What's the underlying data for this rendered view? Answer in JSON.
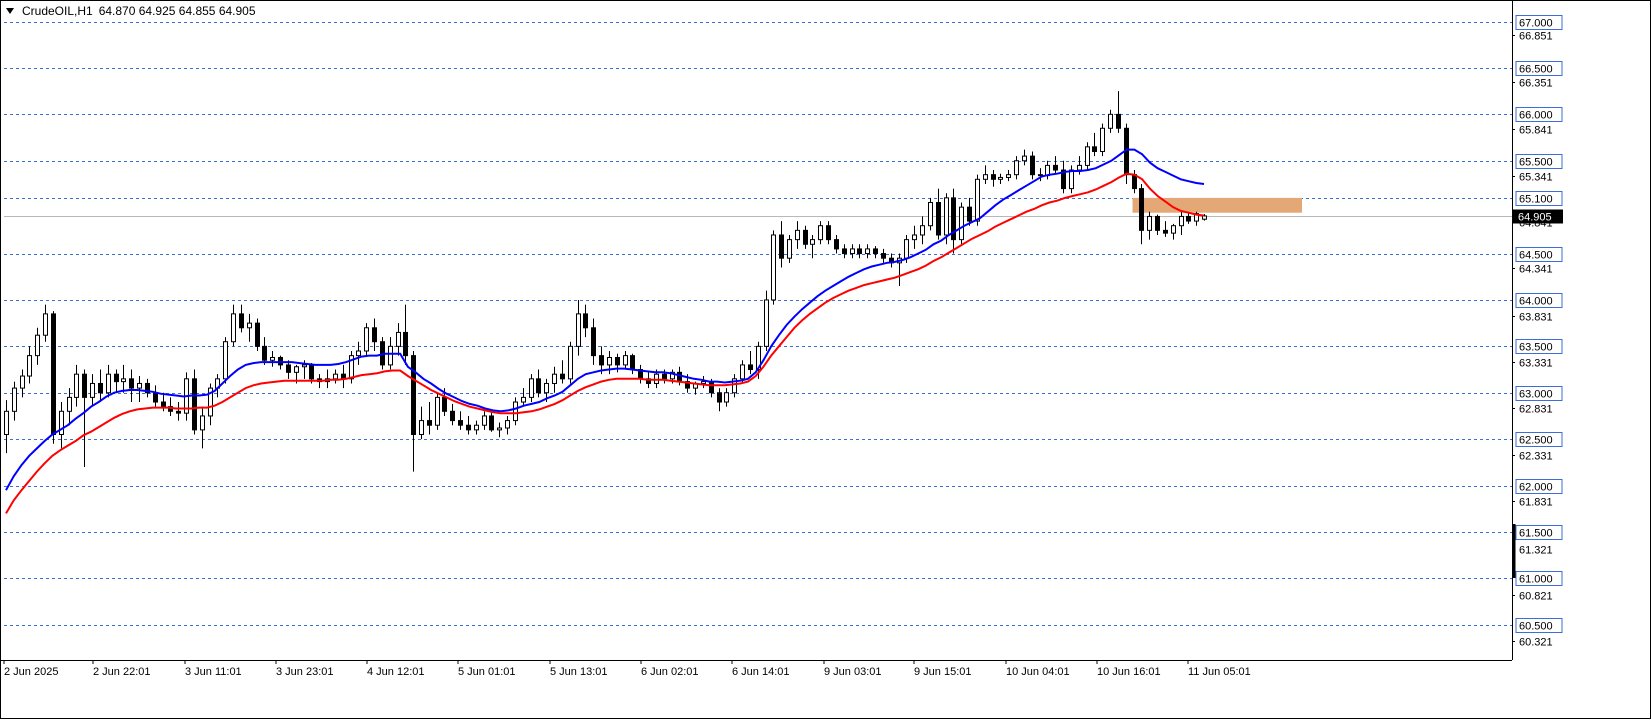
{
  "header": {
    "symbol_tf": "CrudeOIL,H1",
    "ohlc": "64.870 64.925 64.855 64.905"
  },
  "colors": {
    "background": "#ffffff",
    "grid": "#3b6fd6",
    "ema_fast": "#0000ff",
    "ema_slow": "#ff0000",
    "zone": "#e3a875",
    "current_price_bg": "#000000",
    "candle_bull": "#ffffff",
    "candle_bear": "#000000"
  },
  "chart_data": {
    "type": "candlestick",
    "ylim": [
      60.12,
      67.2
    ],
    "grid_levels": [
      67.0,
      66.5,
      66.0,
      65.5,
      65.1,
      64.5,
      64.0,
      63.5,
      63.0,
      62.5,
      62.0,
      61.5,
      61.0,
      60.5
    ],
    "boxed_tick_labels": [
      "67.000",
      "66.500",
      "66.000",
      "65.500",
      "65.100",
      "64.500",
      "64.000",
      "63.500",
      "63.000",
      "62.500",
      "62.000",
      "61.500",
      "61.000",
      "60.500"
    ],
    "plain_tick_labels": [
      "66.851",
      "66.351",
      "65.841",
      "65.341",
      "64.841",
      "64.341",
      "63.831",
      "63.331",
      "62.831",
      "62.331",
      "61.831",
      "61.321",
      "60.821",
      "60.321"
    ],
    "current_price": 64.905,
    "current_price_label": "64.905",
    "x_labels": [
      "2 Jun 2025",
      "2 Jun 22:01",
      "3 Jun 11:01",
      "3 Jun 23:01",
      "4 Jun 12:01",
      "5 Jun 01:01",
      "5 Jun 13:01",
      "6 Jun 02:01",
      "6 Jun 14:01",
      "9 Jun 03:01",
      "9 Jun 15:01",
      "10 Jun 04:01",
      "10 Jun 16:01",
      "11 Jun 05:01"
    ],
    "candles": [
      [
        62.55,
        62.92,
        62.35,
        62.8
      ],
      [
        62.8,
        63.12,
        62.7,
        63.05
      ],
      [
        63.05,
        63.25,
        62.95,
        63.18
      ],
      [
        63.18,
        63.5,
        63.1,
        63.4
      ],
      [
        63.4,
        63.7,
        63.3,
        63.62
      ],
      [
        63.62,
        63.95,
        63.55,
        63.85
      ],
      [
        63.85,
        63.88,
        62.45,
        62.55
      ],
      [
        62.55,
        62.9,
        62.4,
        62.8
      ],
      [
        62.8,
        63.05,
        62.65,
        62.95
      ],
      [
        62.95,
        63.3,
        62.85,
        63.2
      ],
      [
        63.2,
        63.25,
        62.2,
        62.95
      ],
      [
        62.95,
        63.2,
        62.85,
        63.1
      ],
      [
        63.1,
        63.25,
        62.9,
        63.0
      ],
      [
        63.0,
        63.3,
        62.95,
        63.2
      ],
      [
        63.2,
        63.25,
        63.0,
        63.12
      ],
      [
        63.12,
        63.3,
        63.0,
        63.15
      ],
      [
        63.15,
        63.25,
        62.9,
        63.05
      ],
      [
        63.05,
        63.18,
        62.9,
        63.1
      ],
      [
        63.1,
        63.15,
        62.95,
        63.0
      ],
      [
        63.0,
        63.08,
        62.85,
        62.9
      ],
      [
        62.9,
        63.0,
        62.8,
        62.85
      ],
      [
        62.85,
        62.95,
        62.75,
        62.8
      ],
      [
        62.8,
        62.9,
        62.7,
        62.78
      ],
      [
        62.78,
        63.22,
        62.7,
        63.15
      ],
      [
        63.15,
        63.25,
        62.55,
        62.6
      ],
      [
        62.6,
        62.85,
        62.4,
        62.75
      ],
      [
        62.75,
        63.1,
        62.65,
        63.05
      ],
      [
        63.05,
        63.2,
        62.95,
        63.15
      ],
      [
        63.15,
        63.6,
        63.1,
        63.55
      ],
      [
        63.55,
        63.95,
        63.5,
        63.85
      ],
      [
        63.85,
        63.95,
        63.65,
        63.7
      ],
      [
        63.7,
        63.85,
        63.55,
        63.75
      ],
      [
        63.75,
        63.8,
        63.45,
        63.5
      ],
      [
        63.5,
        63.6,
        63.3,
        63.35
      ],
      [
        63.35,
        63.45,
        63.28,
        63.38
      ],
      [
        63.38,
        63.4,
        63.25,
        63.3
      ],
      [
        63.3,
        63.35,
        63.15,
        63.22
      ],
      [
        63.22,
        63.3,
        63.1,
        63.28
      ],
      [
        63.28,
        63.35,
        63.15,
        63.3
      ],
      [
        63.3,
        63.32,
        63.1,
        63.15
      ],
      [
        63.15,
        63.2,
        63.05,
        63.12
      ],
      [
        63.12,
        63.25,
        63.05,
        63.15
      ],
      [
        63.15,
        63.25,
        63.1,
        63.2
      ],
      [
        63.2,
        63.3,
        63.05,
        63.15
      ],
      [
        63.15,
        63.45,
        63.1,
        63.4
      ],
      [
        63.4,
        63.55,
        63.3,
        63.45
      ],
      [
        63.45,
        63.75,
        63.4,
        63.7
      ],
      [
        63.7,
        63.8,
        63.45,
        63.55
      ],
      [
        63.55,
        63.6,
        63.25,
        63.3
      ],
      [
        63.3,
        63.6,
        63.25,
        63.5
      ],
      [
        63.5,
        63.75,
        63.4,
        63.65
      ],
      [
        63.65,
        63.95,
        63.3,
        63.4
      ],
      [
        63.4,
        63.45,
        62.15,
        62.55
      ],
      [
        62.55,
        62.85,
        62.5,
        62.7
      ],
      [
        62.7,
        62.9,
        62.55,
        62.65
      ],
      [
        62.65,
        63.0,
        62.6,
        62.95
      ],
      [
        62.95,
        63.05,
        62.75,
        62.8
      ],
      [
        62.8,
        62.88,
        62.65,
        62.7
      ],
      [
        62.7,
        62.8,
        62.6,
        62.65
      ],
      [
        62.65,
        62.75,
        62.55,
        62.6
      ],
      [
        62.6,
        62.7,
        62.55,
        62.65
      ],
      [
        62.65,
        62.8,
        62.6,
        62.75
      ],
      [
        62.75,
        62.8,
        62.58,
        62.6
      ],
      [
        62.6,
        62.68,
        62.52,
        62.62
      ],
      [
        62.62,
        62.75,
        62.55,
        62.7
      ],
      [
        62.7,
        62.95,
        62.65,
        62.9
      ],
      [
        62.9,
        63.05,
        62.85,
        62.95
      ],
      [
        62.95,
        63.2,
        62.9,
        63.15
      ],
      [
        63.15,
        63.25,
        62.95,
        63.0
      ],
      [
        63.0,
        63.15,
        62.9,
        63.1
      ],
      [
        63.1,
        63.28,
        63.0,
        63.2
      ],
      [
        63.2,
        63.35,
        63.1,
        63.15
      ],
      [
        63.15,
        63.55,
        63.1,
        63.5
      ],
      [
        63.5,
        64.0,
        63.4,
        63.85
      ],
      [
        63.85,
        63.95,
        63.6,
        63.7
      ],
      [
        63.7,
        63.8,
        63.3,
        63.4
      ],
      [
        63.4,
        63.5,
        63.2,
        63.3
      ],
      [
        63.3,
        63.45,
        63.2,
        63.38
      ],
      [
        63.38,
        63.42,
        63.22,
        63.3
      ],
      [
        63.3,
        63.45,
        63.25,
        63.4
      ],
      [
        63.4,
        63.42,
        63.2,
        63.25
      ],
      [
        63.25,
        63.3,
        63.1,
        63.15
      ],
      [
        63.15,
        63.22,
        63.05,
        63.1
      ],
      [
        63.1,
        63.25,
        63.05,
        63.2
      ],
      [
        63.2,
        63.25,
        63.1,
        63.15
      ],
      [
        63.15,
        63.25,
        63.1,
        63.22
      ],
      [
        63.22,
        63.28,
        63.08,
        63.12
      ],
      [
        63.12,
        63.2,
        63.0,
        63.05
      ],
      [
        63.05,
        63.12,
        62.98,
        63.1
      ],
      [
        63.1,
        63.18,
        63.05,
        63.12
      ],
      [
        63.12,
        63.15,
        62.95,
        63.0
      ],
      [
        63.0,
        63.05,
        62.8,
        62.9
      ],
      [
        62.9,
        63.05,
        62.85,
        63.0
      ],
      [
        63.0,
        63.2,
        62.95,
        63.15
      ],
      [
        63.15,
        63.35,
        63.1,
        63.3
      ],
      [
        63.3,
        63.45,
        63.2,
        63.25
      ],
      [
        63.25,
        63.55,
        63.15,
        63.5
      ],
      [
        63.5,
        64.1,
        63.45,
        64.0
      ],
      [
        64.0,
        64.75,
        63.95,
        64.7
      ],
      [
        64.7,
        64.85,
        64.35,
        64.45
      ],
      [
        64.45,
        64.7,
        64.4,
        64.65
      ],
      [
        64.65,
        64.85,
        64.55,
        64.75
      ],
      [
        64.75,
        64.8,
        64.55,
        64.6
      ],
      [
        64.6,
        64.7,
        64.45,
        64.65
      ],
      [
        64.65,
        64.85,
        64.6,
        64.8
      ],
      [
        64.8,
        64.85,
        64.6,
        64.65
      ],
      [
        64.65,
        64.7,
        64.5,
        64.55
      ],
      [
        64.55,
        64.6,
        64.45,
        64.5
      ],
      [
        64.5,
        64.6,
        64.45,
        64.55
      ],
      [
        64.55,
        64.6,
        64.45,
        64.5
      ],
      [
        64.5,
        64.6,
        64.45,
        64.55
      ],
      [
        64.55,
        64.58,
        64.45,
        64.5
      ],
      [
        64.5,
        64.55,
        64.4,
        64.45
      ],
      [
        64.45,
        64.5,
        64.35,
        64.4
      ],
      [
        64.4,
        64.5,
        64.15,
        64.45
      ],
      [
        64.45,
        64.7,
        64.4,
        64.65
      ],
      [
        64.65,
        64.8,
        64.55,
        64.7
      ],
      [
        64.7,
        64.9,
        64.6,
        64.8
      ],
      [
        64.8,
        65.1,
        64.75,
        65.05
      ],
      [
        65.05,
        65.2,
        64.65,
        64.7
      ],
      [
        64.7,
        65.15,
        64.6,
        65.1
      ],
      [
        65.1,
        65.2,
        64.5,
        64.65
      ],
      [
        64.65,
        65.05,
        64.6,
        65.0
      ],
      [
        65.0,
        65.1,
        64.8,
        64.85
      ],
      [
        64.85,
        65.35,
        64.8,
        65.3
      ],
      [
        65.3,
        65.45,
        65.25,
        65.35
      ],
      [
        65.35,
        65.4,
        65.22,
        65.3
      ],
      [
        65.3,
        65.36,
        65.25,
        65.32
      ],
      [
        65.32,
        65.4,
        65.28,
        65.35
      ],
      [
        65.35,
        65.55,
        65.3,
        65.5
      ],
      [
        65.5,
        65.62,
        65.45,
        65.55
      ],
      [
        65.55,
        65.6,
        65.3,
        65.35
      ],
      [
        65.35,
        65.42,
        65.28,
        65.34
      ],
      [
        65.34,
        65.5,
        65.3,
        65.45
      ],
      [
        65.45,
        65.55,
        65.35,
        65.4
      ],
      [
        65.4,
        65.5,
        65.15,
        65.2
      ],
      [
        65.2,
        65.45,
        65.15,
        65.4
      ],
      [
        65.4,
        65.55,
        65.35,
        65.45
      ],
      [
        65.45,
        65.7,
        65.4,
        65.65
      ],
      [
        65.65,
        65.8,
        65.55,
        65.6
      ],
      [
        65.6,
        65.9,
        65.55,
        65.85
      ],
      [
        65.85,
        66.05,
        65.8,
        66.0
      ],
      [
        66.0,
        66.25,
        65.8,
        65.85
      ],
      [
        65.85,
        65.9,
        65.25,
        65.35
      ],
      [
        65.35,
        65.4,
        65.15,
        65.2
      ],
      [
        65.2,
        65.25,
        64.6,
        64.75
      ],
      [
        64.75,
        64.95,
        64.65,
        64.9
      ],
      [
        64.9,
        64.92,
        64.7,
        64.75
      ],
      [
        64.75,
        64.85,
        64.68,
        64.72
      ],
      [
        64.72,
        64.82,
        64.65,
        64.8
      ],
      [
        64.8,
        64.95,
        64.7,
        64.9
      ],
      [
        64.9,
        64.95,
        64.82,
        64.85
      ],
      [
        64.85,
        64.95,
        64.8,
        64.93
      ],
      [
        64.87,
        64.925,
        64.855,
        64.905
      ]
    ],
    "series": [
      {
        "values": [
          61.95,
          62.1,
          62.22,
          62.32,
          62.4,
          62.48,
          62.55,
          62.6,
          62.65,
          62.72,
          62.78,
          62.85,
          62.9,
          62.96,
          63.0,
          63.02,
          63.03,
          63.03,
          63.02,
          63.01,
          62.99,
          62.98,
          62.97,
          62.96,
          62.97,
          62.97,
          62.98,
          63.02,
          63.1,
          63.18,
          63.25,
          63.3,
          63.32,
          63.33,
          63.33,
          63.33,
          63.33,
          63.33,
          63.32,
          63.31,
          63.3,
          63.3,
          63.3,
          63.31,
          63.33,
          63.36,
          63.39,
          63.4,
          63.4,
          63.42,
          63.42,
          63.42,
          63.28,
          63.22,
          63.15,
          63.1,
          63.04,
          62.99,
          62.95,
          62.91,
          62.88,
          62.86,
          62.83,
          62.81,
          62.8,
          62.81,
          62.83,
          62.86,
          62.88,
          62.9,
          62.94,
          62.97,
          63.01,
          63.08,
          63.15,
          63.2,
          63.22,
          63.24,
          63.25,
          63.26,
          63.26,
          63.25,
          63.24,
          63.23,
          63.22,
          63.22,
          63.21,
          63.19,
          63.17,
          63.15,
          63.14,
          63.12,
          63.12,
          63.11,
          63.12,
          63.13,
          63.15,
          63.22,
          63.35,
          63.5,
          63.62,
          63.73,
          63.82,
          63.9,
          63.97,
          64.04,
          64.1,
          64.15,
          64.2,
          64.25,
          64.29,
          64.33,
          64.36,
          64.38,
          64.4,
          64.41,
          64.43,
          64.46,
          64.5,
          64.54,
          64.6,
          64.64,
          64.7,
          64.75,
          64.8,
          64.84,
          64.88,
          64.95,
          65.02,
          65.08,
          65.13,
          65.18,
          65.23,
          65.28,
          65.33,
          65.35,
          65.36,
          65.38,
          65.39,
          65.39,
          65.4,
          65.42,
          65.46,
          65.5,
          65.56,
          65.62,
          65.62,
          65.57,
          65.48,
          65.42,
          65.38,
          65.34,
          65.3,
          65.28,
          65.26,
          65.25
        ]
      },
      {
        "values": [
          61.7,
          61.84,
          61.95,
          62.05,
          62.15,
          62.24,
          62.32,
          62.38,
          62.43,
          62.48,
          62.54,
          62.58,
          62.63,
          62.68,
          62.73,
          62.77,
          62.8,
          62.82,
          62.83,
          62.84,
          62.84,
          62.84,
          62.83,
          62.83,
          62.83,
          62.84,
          62.84,
          62.86,
          62.9,
          62.95,
          63.0,
          63.05,
          63.08,
          63.1,
          63.11,
          63.12,
          63.13,
          63.13,
          63.13,
          63.13,
          63.13,
          63.13,
          63.14,
          63.14,
          63.15,
          63.17,
          63.19,
          63.2,
          63.21,
          63.23,
          63.24,
          63.24,
          63.18,
          63.13,
          63.08,
          63.03,
          62.99,
          62.95,
          62.91,
          62.88,
          62.85,
          62.83,
          62.81,
          62.79,
          62.78,
          62.78,
          62.78,
          62.79,
          62.8,
          62.82,
          62.85,
          62.88,
          62.92,
          62.97,
          63.02,
          63.06,
          63.09,
          63.12,
          63.14,
          63.15,
          63.15,
          63.15,
          63.15,
          63.14,
          63.14,
          63.14,
          63.13,
          63.12,
          63.11,
          63.1,
          63.09,
          63.08,
          63.08,
          63.08,
          63.09,
          63.1,
          63.12,
          63.18,
          63.28,
          63.4,
          63.5,
          63.6,
          63.7,
          63.78,
          63.85,
          63.91,
          63.97,
          64.02,
          64.06,
          64.1,
          64.13,
          64.16,
          64.18,
          64.2,
          64.22,
          64.24,
          64.27,
          64.3,
          64.33,
          64.37,
          64.42,
          64.46,
          64.51,
          64.56,
          64.61,
          64.66,
          64.7,
          64.74,
          64.79,
          64.83,
          64.87,
          64.91,
          64.95,
          64.98,
          65.02,
          65.05,
          65.07,
          65.1,
          65.12,
          65.14,
          65.16,
          65.19,
          65.23,
          65.27,
          65.32,
          65.36,
          65.35,
          65.3,
          65.2,
          65.12,
          65.06,
          65.0,
          64.96,
          64.94,
          64.92,
          64.91
        ]
      }
    ],
    "zone": [
      65.1,
      64.94
    ]
  }
}
